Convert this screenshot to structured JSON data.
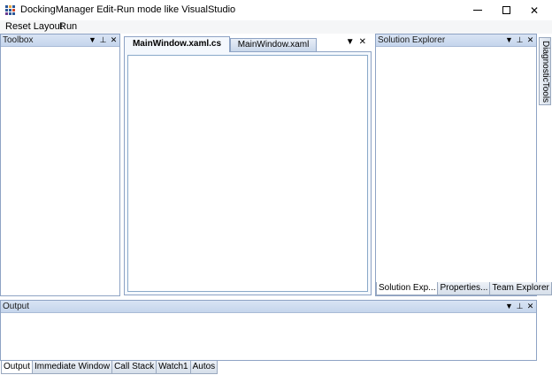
{
  "window": {
    "title": "DockingManager Edit-Run mode like VisualStudio",
    "icon_colors": [
      "#2b5797",
      "#e8a33d",
      "#2b5797",
      "#2b5797",
      "#2b5797",
      "#d24726",
      "#6a3b8f",
      "#2b5797",
      "#2b5797"
    ]
  },
  "caption_buttons": {
    "minimize_icon": "minimize-icon",
    "maximize_icon": "maximize-icon",
    "close_icon": "close-icon",
    "close_glyph": "✕"
  },
  "menu": {
    "items": [
      "Reset Layout",
      "Run"
    ]
  },
  "panels": {
    "toolbox": {
      "title": "Toolbox"
    },
    "solution_explorer": {
      "title": "Solution Explorer",
      "tabs": [
        "Solution Exp...",
        "Properties...",
        "Team Explorer"
      ]
    },
    "output": {
      "title": "Output",
      "tabs": [
        "Output",
        "Immediate Window",
        "Call Stack",
        "Watch1",
        "Autos"
      ]
    }
  },
  "pane_buttons": {
    "dropdown": "▼",
    "pin": "⊥",
    "close": "✕"
  },
  "documents": {
    "tabs": [
      "MainWindow.xaml.cs",
      "MainWindow.xaml"
    ],
    "active": "MainWindow.xaml.cs"
  },
  "side_tabs": [
    "DiagnosticTools"
  ],
  "colors": {
    "header_gradient_top": "#d9e4f4",
    "header_gradient_bottom": "#c5d5ec",
    "border": "#8ea3c4"
  }
}
